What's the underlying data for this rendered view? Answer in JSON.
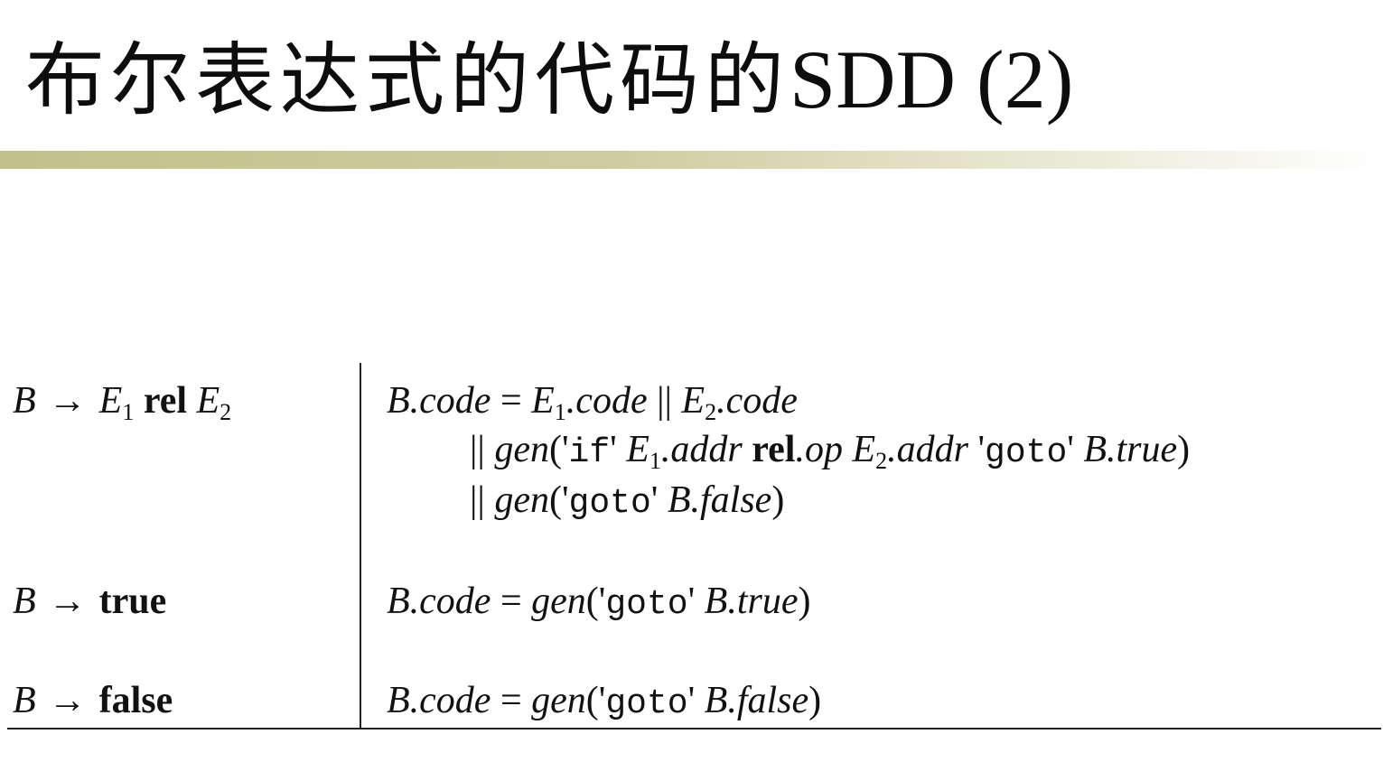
{
  "slide": {
    "title_cjk": "布尔表达式的代码的",
    "title_latin": "SDD (2)"
  },
  "colors": {
    "rule_gradient_start": "#c2c08a",
    "rule_gradient_end": "#ffffff",
    "ink": "#111111"
  },
  "rows": [
    {
      "production": {
        "lhs": "B",
        "arrow": "→",
        "parts": [
          "E",
          "1",
          "rel",
          "E",
          "2"
        ]
      },
      "rules": [
        "B.code = E1.code || E2.code",
        "|| gen('if' E1.addr rel.op E2.addr 'goto' B.true)",
        "|| gen('goto' B.false)"
      ]
    },
    {
      "production": {
        "lhs": "B",
        "arrow": "→",
        "parts": [
          "true"
        ]
      },
      "rules": [
        "B.code = gen('goto' B.true)"
      ]
    },
    {
      "production": {
        "lhs": "B",
        "arrow": "→",
        "parts": [
          "false"
        ]
      },
      "rules": [
        "B.code = gen('goto' B.false)"
      ]
    }
  ],
  "tokens": {
    "B": "B",
    "E": "E",
    "sub1": "1",
    "sub2": "2",
    "rel": "rel",
    "true_kw": "true",
    "false_kw": "false",
    "arrow": "→",
    "dot_code": ".code",
    "eq": " = ",
    "concat": " || ",
    "concat_lead": "|| ",
    "gen_open": "gen('",
    "if_kw": "if",
    "q_close": "' ",
    "dot_addr": ".addr",
    "rel_op_prefix": "rel",
    "dot_op": ".op",
    "q_open": " '",
    "goto_kw": "goto",
    "dot_true": ".true",
    "dot_false": ".false",
    "close_paren": ")"
  }
}
